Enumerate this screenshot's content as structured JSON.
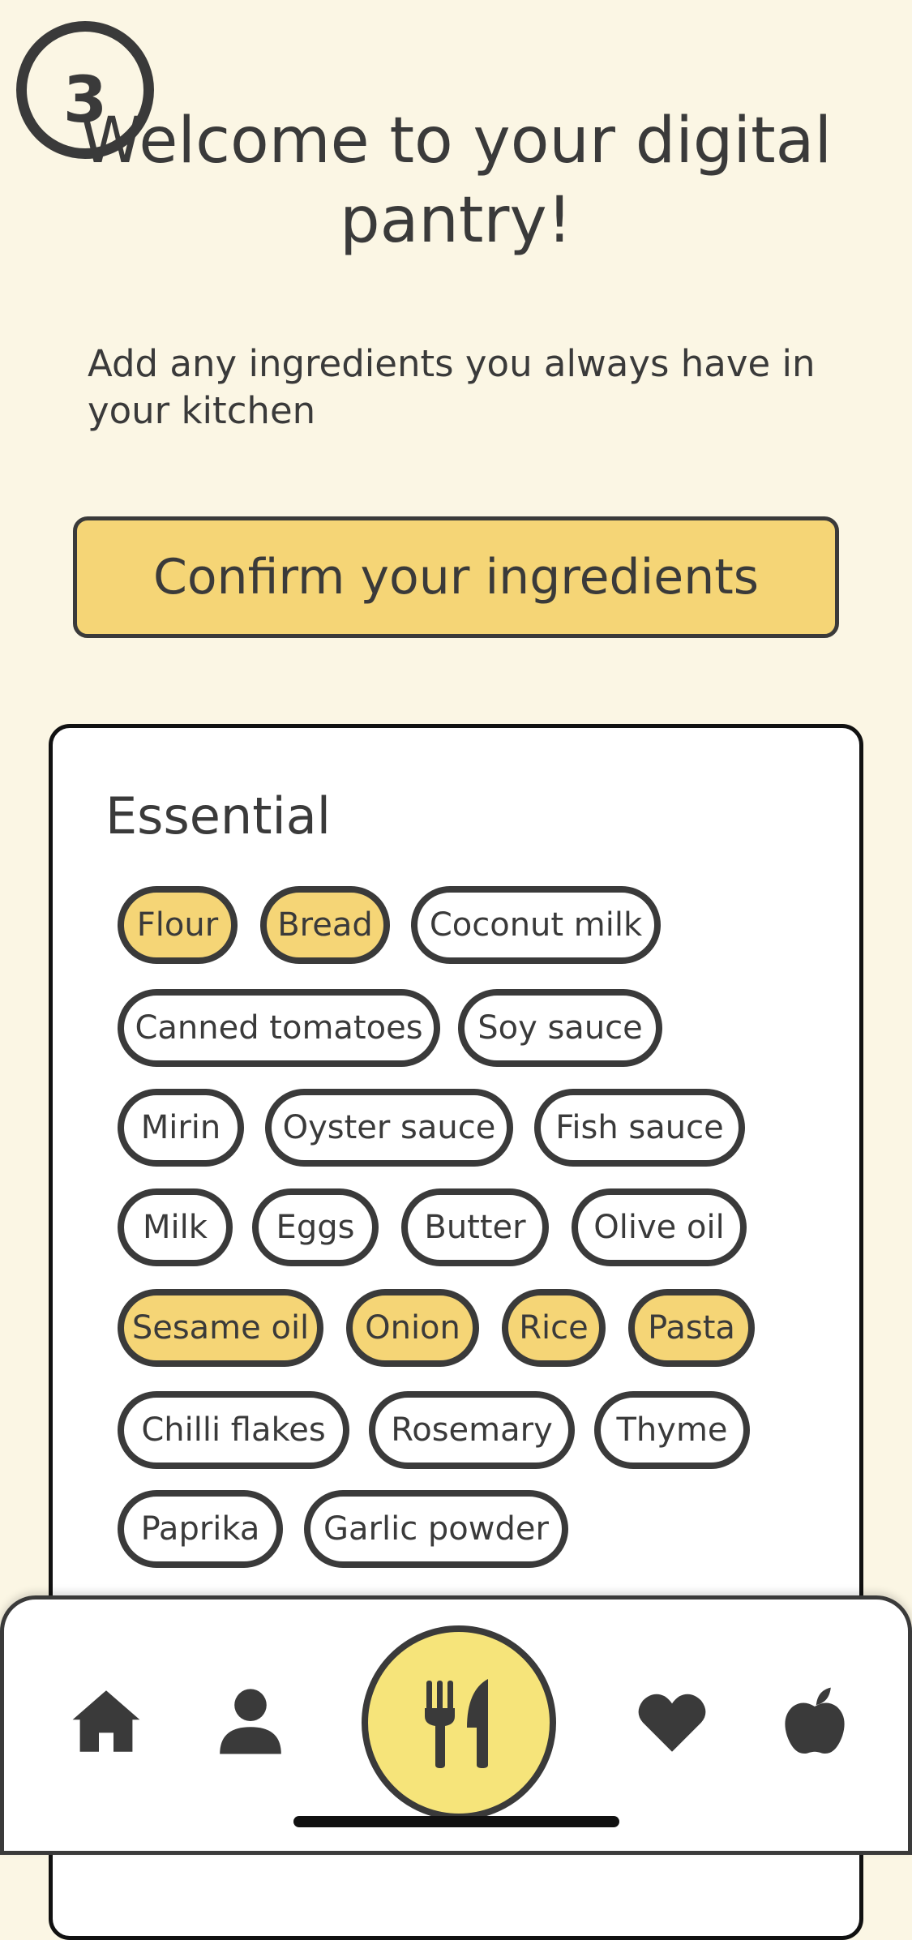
{
  "step": {
    "number": "3"
  },
  "header": {
    "title": "Welcome to your digital pantry!",
    "subtitle": "Add any ingredients you always have in your kitchen"
  },
  "confirm_button": {
    "label": "Confirm your ingredients"
  },
  "essential": {
    "title": "Essential",
    "chips": [
      {
        "label": "Flour",
        "selected": true
      },
      {
        "label": "Bread",
        "selected": true
      },
      {
        "label": "Coconut milk",
        "selected": false
      },
      {
        "label": "Canned tomatoes",
        "selected": false
      },
      {
        "label": "Soy sauce",
        "selected": false
      },
      {
        "label": "Mirin",
        "selected": false
      },
      {
        "label": "Oyster sauce",
        "selected": false
      },
      {
        "label": "Fish sauce",
        "selected": false
      },
      {
        "label": "Milk",
        "selected": false
      },
      {
        "label": "Eggs",
        "selected": false
      },
      {
        "label": "Butter",
        "selected": false
      },
      {
        "label": "Olive oil",
        "selected": false
      },
      {
        "label": "Sesame oil",
        "selected": true
      },
      {
        "label": "Onion",
        "selected": true
      },
      {
        "label": "Rice",
        "selected": true
      },
      {
        "label": "Pasta",
        "selected": true
      },
      {
        "label": "Chilli flakes",
        "selected": false
      },
      {
        "label": "Rosemary",
        "selected": false
      },
      {
        "label": "Thyme",
        "selected": false
      },
      {
        "label": "Paprika",
        "selected": false
      },
      {
        "label": "Garlic powder",
        "selected": false
      }
    ]
  },
  "nav": {
    "items": [
      {
        "icon": "home-icon"
      },
      {
        "icon": "user-icon"
      },
      {
        "icon": "fork-knife-icon",
        "active": true
      },
      {
        "icon": "heart-icon"
      },
      {
        "icon": "apple-icon"
      }
    ]
  },
  "colors": {
    "accent": "#f5d576",
    "nav_active": "#f6e47a",
    "text": "#3a3a3a",
    "background": "#fbf6e4"
  }
}
